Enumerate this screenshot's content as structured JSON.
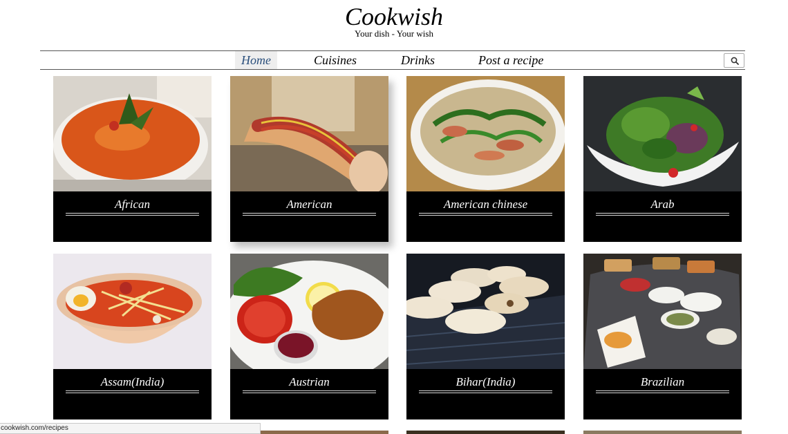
{
  "site": {
    "title": "Cookwish",
    "tagline": "Your dish - Your wish"
  },
  "nav": {
    "items": [
      {
        "label": "Home",
        "active": true
      },
      {
        "label": "Cuisines",
        "active": false
      },
      {
        "label": "Drinks",
        "active": false
      },
      {
        "label": "Post a recipe",
        "active": false
      }
    ],
    "search_icon": "search-icon"
  },
  "cuisines": [
    {
      "label": "African",
      "image": "orange curry bowl"
    },
    {
      "label": "American",
      "image": "hot dog with ketchup and mustard"
    },
    {
      "label": "American chinese",
      "image": "noodle soup bowl"
    },
    {
      "label": "Arab",
      "image": "leafy salad plate"
    },
    {
      "label": "Assam(India)",
      "image": "noodle bowl with egg"
    },
    {
      "label": "Austrian",
      "image": "schnitzel with lemon and tomato"
    },
    {
      "label": "Bihar(India)",
      "image": "breads on grill"
    },
    {
      "label": "Brazilian",
      "image": "buffet platters"
    }
  ],
  "status_bar": {
    "url": "cookwish.com/recipes"
  }
}
